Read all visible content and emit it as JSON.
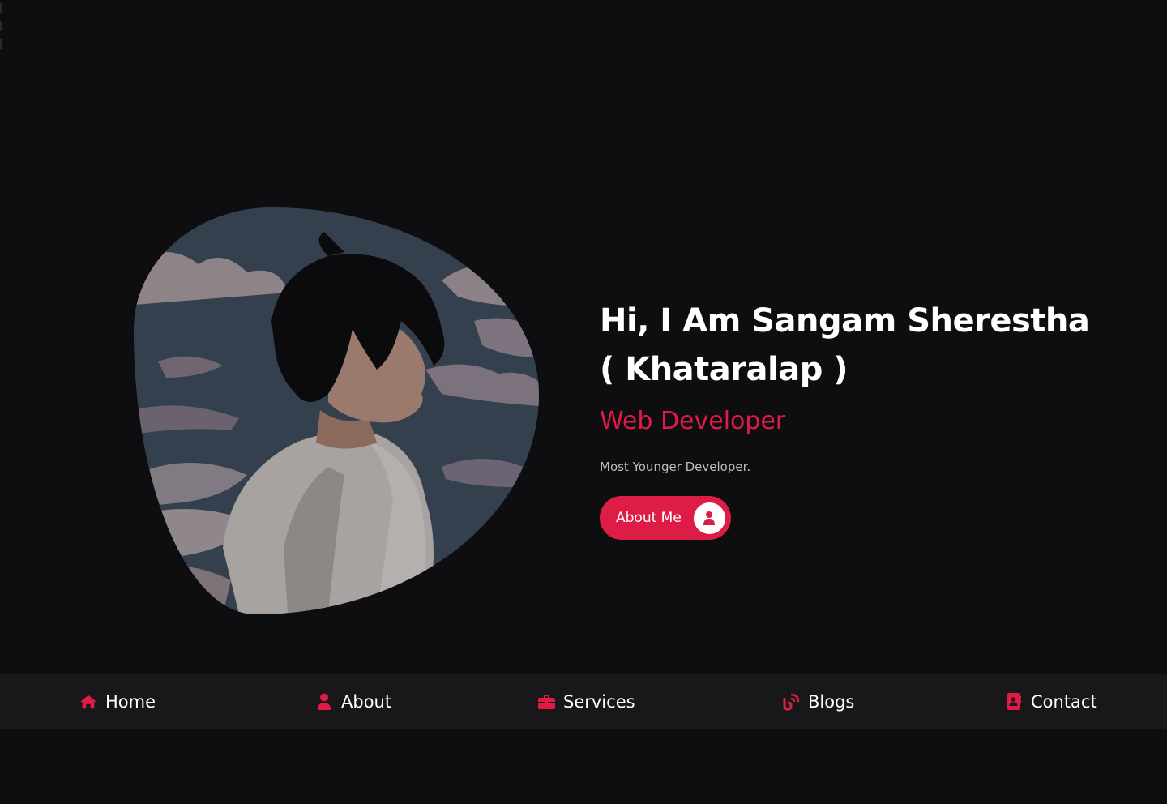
{
  "hero": {
    "headline_line1": "Hi, I Am Sangam Sherestha",
    "headline_line2": "( Khataralap )",
    "role": "Web Developer",
    "tagline": "Most Younger Developer.",
    "about_button_label": "About Me",
    "about_button_icon": "user-icon"
  },
  "nav": {
    "items": [
      {
        "label": "Home",
        "icon": "home-icon"
      },
      {
        "label": "About",
        "icon": "user-icon"
      },
      {
        "label": "Services",
        "icon": "briefcase-icon"
      },
      {
        "label": "Blogs",
        "icon": "blog-icon"
      },
      {
        "label": "Contact",
        "icon": "address-book-icon"
      }
    ]
  },
  "colors": {
    "background": "#0e0e10",
    "accent": "#e11a48",
    "nav_background": "#18181a",
    "text": "#ffffff",
    "muted_text": "#bdbdbd"
  }
}
